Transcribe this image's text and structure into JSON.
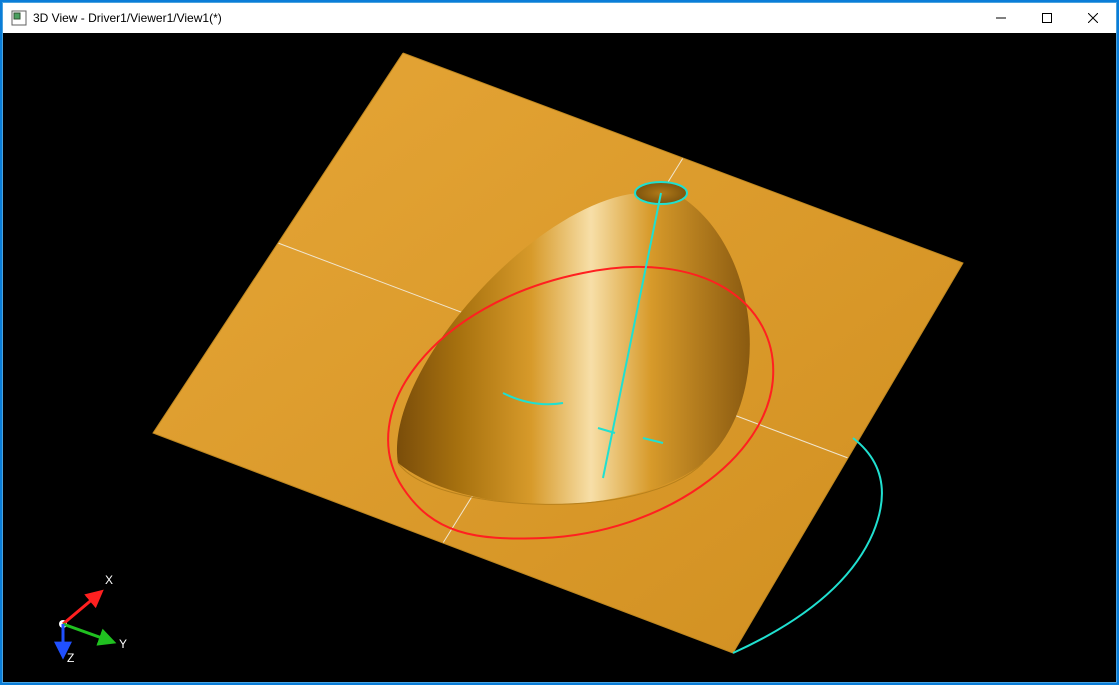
{
  "window": {
    "title": "3D View - Driver1/Viewer1/View1(*)"
  },
  "triad": {
    "x": "X",
    "y": "Y",
    "z": "Z"
  },
  "colors": {
    "intersection_curve": "#ff2020",
    "construction_curve": "#20e0d0",
    "surface_light": "#efb24a",
    "surface_mid": "#d89a2a",
    "surface_dark": "#a67018",
    "cone_highlight": "#f7dfa8",
    "axis_x": "#ff2020",
    "axis_y": "#20c020",
    "axis_z": "#2050ff"
  },
  "scene": {
    "description": "Planar rectangular surface intersected by a truncated cone. Cyan construction curves (axis line, circular cross-sections, partial base arc) and a red closed intersection curve (ellipse-like) between cone and plane are displayed. A 3D orientation triad sits in the lower-left corner.",
    "objects": [
      "rectangular_plane",
      "truncated_cone",
      "intersection_curve",
      "construction_curves"
    ],
    "view": "isometric"
  }
}
